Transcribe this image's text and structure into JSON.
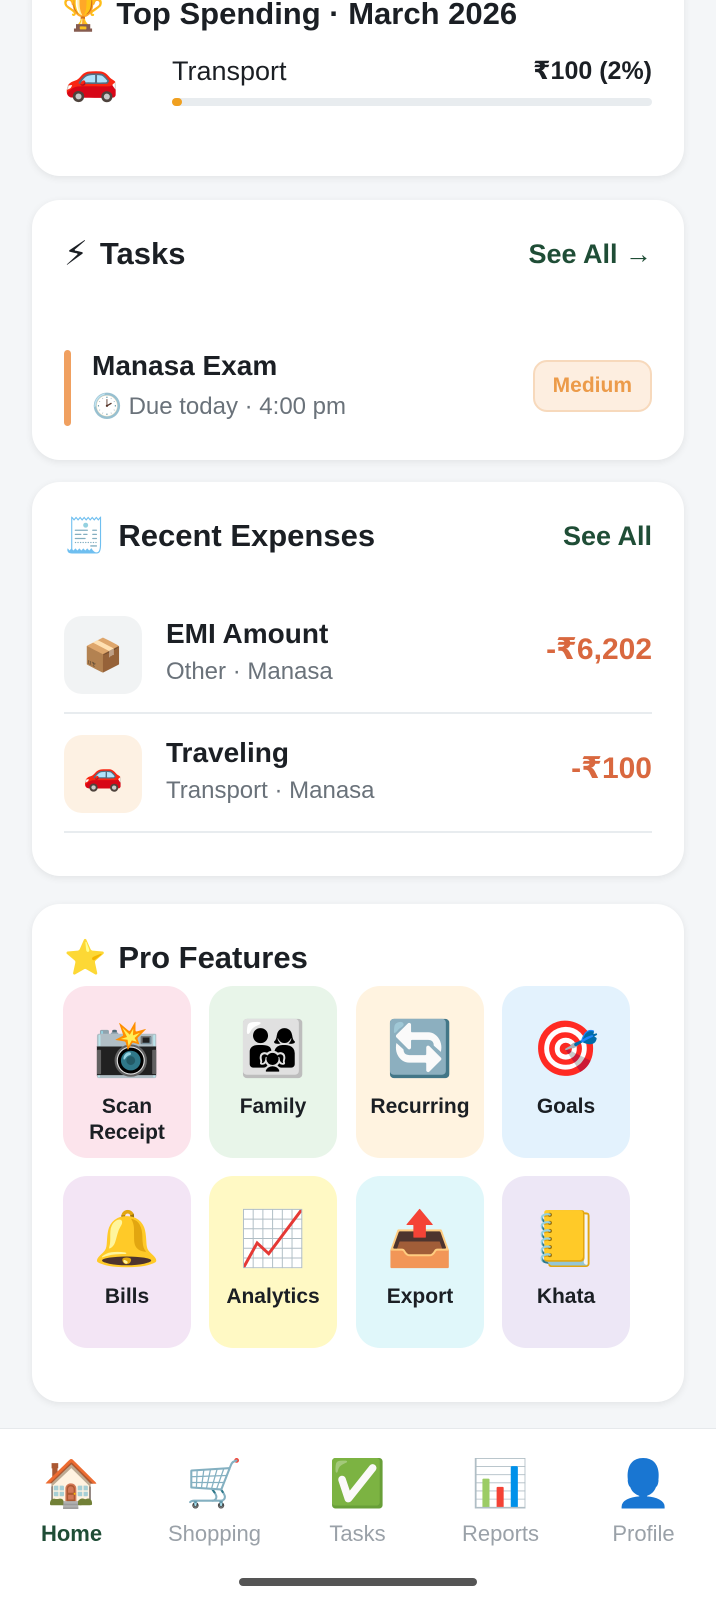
{
  "top_spending": {
    "title": "Top Spending · March 2026",
    "title_icon": "trophy-icon",
    "item": {
      "icon": "car-icon",
      "label": "Transport",
      "value": "₹100 (2%)",
      "percent": 2,
      "bar_color": "#f0a020"
    }
  },
  "tasks": {
    "title": "Tasks",
    "title_icon": "lightning-icon",
    "see_all": "See All →",
    "items": [
      {
        "title": "Manasa Exam",
        "due": "Due today · 4:00 pm",
        "due_icon": "clock-icon",
        "priority": "Medium",
        "accent": "#f0a060"
      }
    ]
  },
  "recent_expenses": {
    "title": "Recent Expenses",
    "title_icon": "receipt-icon",
    "see_all": "See All",
    "items": [
      {
        "icon": "package-icon",
        "icon_bg": "#f1f3f4",
        "title": "EMI Amount",
        "sub": "Other · Manasa",
        "amount": "-₹6,202"
      },
      {
        "icon": "car-icon",
        "icon_bg": "#fdf1e3",
        "title": "Traveling",
        "sub": "Transport · Manasa",
        "amount": "-₹100"
      }
    ]
  },
  "pro_features": {
    "title": "Pro Features",
    "title_icon": "star-icon",
    "items": [
      {
        "label": "Scan Receipt",
        "icon": "camera-flash-icon",
        "bg": "#fce4ec"
      },
      {
        "label": "Family",
        "icon": "family-icon",
        "bg": "#e8f5e9"
      },
      {
        "label": "Recurring",
        "icon": "repeat-icon",
        "bg": "#fff3e0"
      },
      {
        "label": "Goals",
        "icon": "target-icon",
        "bg": "#e3f2fd"
      },
      {
        "label": "Bills",
        "icon": "bell-icon",
        "bg": "#f3e5f5"
      },
      {
        "label": "Analytics",
        "icon": "chart-up-icon",
        "bg": "#fff9c4"
      },
      {
        "label": "Export",
        "icon": "outbox-icon",
        "bg": "#e0f7fa"
      },
      {
        "label": "Khata",
        "icon": "notebook-icon",
        "bg": "#ede7f6"
      }
    ]
  },
  "bottom_nav": {
    "items": [
      {
        "label": "Home",
        "icon": "house-icon",
        "active": true
      },
      {
        "label": "Shopping",
        "icon": "cart-icon",
        "active": false
      },
      {
        "label": "Tasks",
        "icon": "check-box-icon",
        "active": false
      },
      {
        "label": "Reports",
        "icon": "bar-chart-icon",
        "active": false
      },
      {
        "label": "Profile",
        "icon": "user-icon",
        "active": false
      }
    ]
  },
  "colors": {
    "accent_green": "#1f4d36",
    "expense_red": "#d9683f",
    "priority_orange": "#ec9b4a"
  }
}
